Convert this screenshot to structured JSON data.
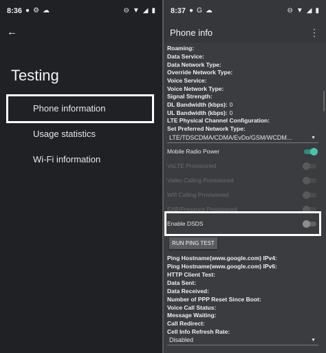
{
  "left": {
    "status": {
      "time": "8:36"
    },
    "title": "Testing",
    "menu": [
      {
        "label": "Phone information"
      },
      {
        "label": "Usage statistics"
      },
      {
        "label": "Wi-Fi information"
      }
    ]
  },
  "right": {
    "status": {
      "time": "8:37"
    },
    "appbar_title": "Phone info",
    "fields": [
      {
        "label": "Roaming:",
        "value": ""
      },
      {
        "label": "Data Service:",
        "value": ""
      },
      {
        "label": "Data Network Type:",
        "value": ""
      },
      {
        "label": "Override Network Type:",
        "value": ""
      },
      {
        "label": "Voice Service:",
        "value": ""
      },
      {
        "label": "Voice Network Type:",
        "value": ""
      },
      {
        "label": "Signal Strength:",
        "value": ""
      },
      {
        "label": "DL Bandwidth (kbps):",
        "value": "0"
      },
      {
        "label": "UL Bandwidth (kbps):",
        "value": "0"
      },
      {
        "label": "LTE Physical Channel Configuration:",
        "value": ""
      },
      {
        "label": "Set Preferred Network Type:",
        "value": ""
      }
    ],
    "preferred_network_value": "LTE/TDSCDMA/CDMA/EvDo/GSM/WCDM...",
    "toggles": [
      {
        "label": "Mobile Radio Power",
        "state": "on"
      },
      {
        "label": "VoLTE Provisioned",
        "state": "disabled"
      },
      {
        "label": "Video Calling Provisioned",
        "state": "disabled"
      },
      {
        "label": "Wifi Calling Provisioned",
        "state": "disabled"
      },
      {
        "label": "EAB/Presence Provisioned",
        "state": "disabled"
      }
    ],
    "dsds": {
      "label": "Enable DSDS",
      "state": "off"
    },
    "ping_button": "RUN PING TEST",
    "fields2": [
      {
        "label": "Ping Hostname(www.google.com) IPv4:"
      },
      {
        "label": "Ping Hostname(www.google.com) IPv6:"
      },
      {
        "label": "HTTP Client Test:"
      },
      {
        "label": "Data Sent:"
      },
      {
        "label": "Data Received:"
      },
      {
        "label": "Number of PPP Reset Since Boot:"
      },
      {
        "label": "Voice Call Status:"
      },
      {
        "label": "Message Waiting:"
      },
      {
        "label": "Call Redirect:"
      },
      {
        "label": "Cell Info Refresh Rate:"
      }
    ],
    "refresh_rate_value": "Disabled"
  },
  "colors": {
    "accent": "#4fc3a9",
    "highlight": "#ffffff"
  }
}
